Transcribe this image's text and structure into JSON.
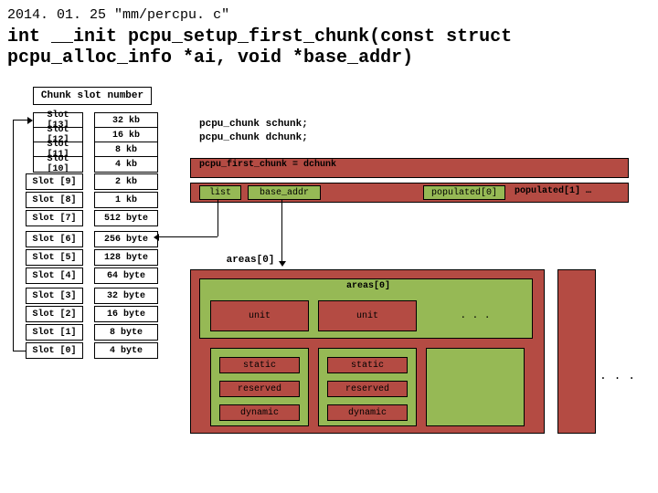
{
  "header": {
    "date": "2014. 01. 25",
    "file": "\"mm/percpu. c\"",
    "signature": "int __init pcpu_setup_first_chunk(const struct pcpu_alloc_info *ai, void *base_addr)"
  },
  "slots": {
    "caption": "Chunk slot number",
    "rows": [
      {
        "label": "Slot [13]",
        "size": "32 kb"
      },
      {
        "label": "Slot [12]",
        "size": "16 kb"
      },
      {
        "label": "Slot [11]",
        "size": "8 kb"
      },
      {
        "label": "Slot [10]",
        "size": "4 kb"
      },
      {
        "label": "Slot [9]",
        "size": "2 kb"
      },
      {
        "label": "Slot [8]",
        "size": "1 kb"
      },
      {
        "label": "Slot [7]",
        "size": "512 byte"
      },
      {
        "label": "Slot [6]",
        "size": "256 byte"
      },
      {
        "label": "Slot [5]",
        "size": "128 byte"
      },
      {
        "label": "Slot [4]",
        "size": "64 byte"
      },
      {
        "label": "Slot [3]",
        "size": "32 byte"
      },
      {
        "label": "Slot [2]",
        "size": "16 byte"
      },
      {
        "label": "Slot [1]",
        "size": "8 byte"
      },
      {
        "label": "Slot [0]",
        "size": "4 byte"
      }
    ]
  },
  "decls": {
    "schunk": "pcpu_chunk schunk;",
    "dchunk": "pcpu_chunk dchunk;"
  },
  "first_chunk": {
    "label": "pcpu_first_chunk = dchunk",
    "fields": {
      "list": "list",
      "base_addr": "base_addr",
      "pop0": "populated[0]",
      "pop1": "populated[1] …"
    }
  },
  "areas": {
    "group_label": "areas[0]",
    "inner_label": "areas[0]",
    "unit": "unit",
    "dots": ". . .",
    "mem": {
      "static": "static",
      "reserved": "reserved",
      "dynamic": "dynamic"
    }
  }
}
